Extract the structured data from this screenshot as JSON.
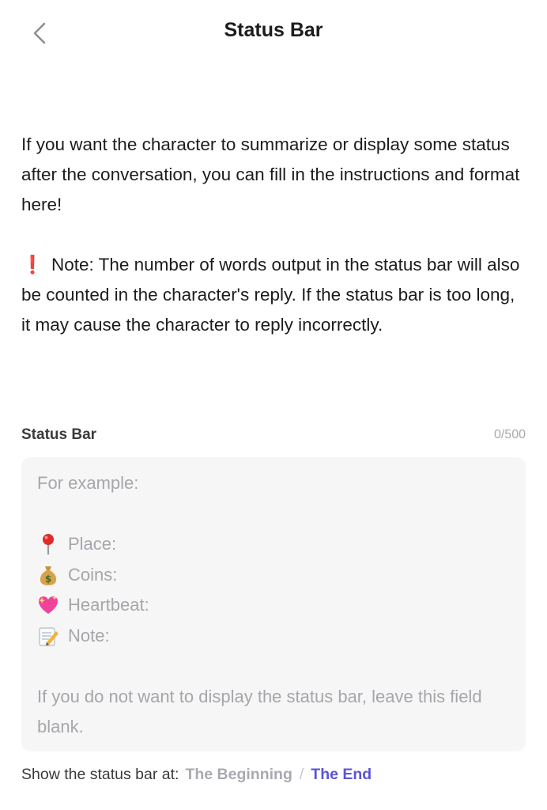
{
  "header": {
    "title": "Status Bar",
    "back_icon": "chevron-left-icon"
  },
  "intro": {
    "paragraph1": "If you want the character to summarize or display some status after the conversation, you can fill in the instructions and format here!",
    "note_mark": "❗",
    "note_text": "Note: The number of words output in the status bar will also be counted in the character's reply. If the status bar is too long, it may cause the character to reply incorrectly."
  },
  "field": {
    "label": "Status Bar",
    "counter": "0/500",
    "value": "",
    "placeholder": {
      "line1": "For example:",
      "items": [
        {
          "icon": "pin-icon",
          "label": "Place:"
        },
        {
          "icon": "money-bag-icon",
          "label": "Coins:"
        },
        {
          "icon": "sparkling-heart-icon",
          "label": "Heartbeat:"
        },
        {
          "icon": "memo-icon",
          "label": "Note:"
        }
      ],
      "footer": "If you do not want to display the status bar, leave this field blank."
    }
  },
  "position": {
    "label": "Show the status bar at:",
    "option_beginning": "The Beginning",
    "separator": "/",
    "option_end": "The End",
    "selected": "The End"
  },
  "colors": {
    "accent": "#5b53d6",
    "note_mark": "#e0201c",
    "placeholder": "#a6a6ab",
    "field_bg": "#f6f6f7"
  }
}
